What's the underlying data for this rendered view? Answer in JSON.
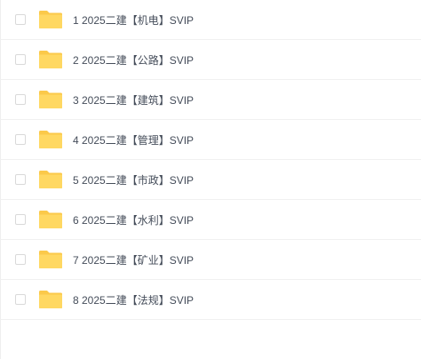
{
  "colors": {
    "folder_back": "#fbc94a",
    "folder_front": "#ffd862",
    "text": "#454d5a",
    "divider": "#f0f0f0"
  },
  "items": [
    {
      "name": "1 2025二建【机电】SVIP",
      "icon": "folder-icon"
    },
    {
      "name": "2 2025二建【公路】SVIP",
      "icon": "folder-icon"
    },
    {
      "name": "3 2025二建【建筑】SVIP",
      "icon": "folder-icon"
    },
    {
      "name": "4 2025二建【管理】SVIP",
      "icon": "folder-icon"
    },
    {
      "name": "5 2025二建【市政】SVIP",
      "icon": "folder-icon"
    },
    {
      "name": "6 2025二建【水利】SVIP",
      "icon": "folder-icon"
    },
    {
      "name": "7 2025二建【矿业】SVIP",
      "icon": "folder-icon"
    },
    {
      "name": "8 2025二建【法规】SVIP",
      "icon": "folder-icon"
    }
  ]
}
